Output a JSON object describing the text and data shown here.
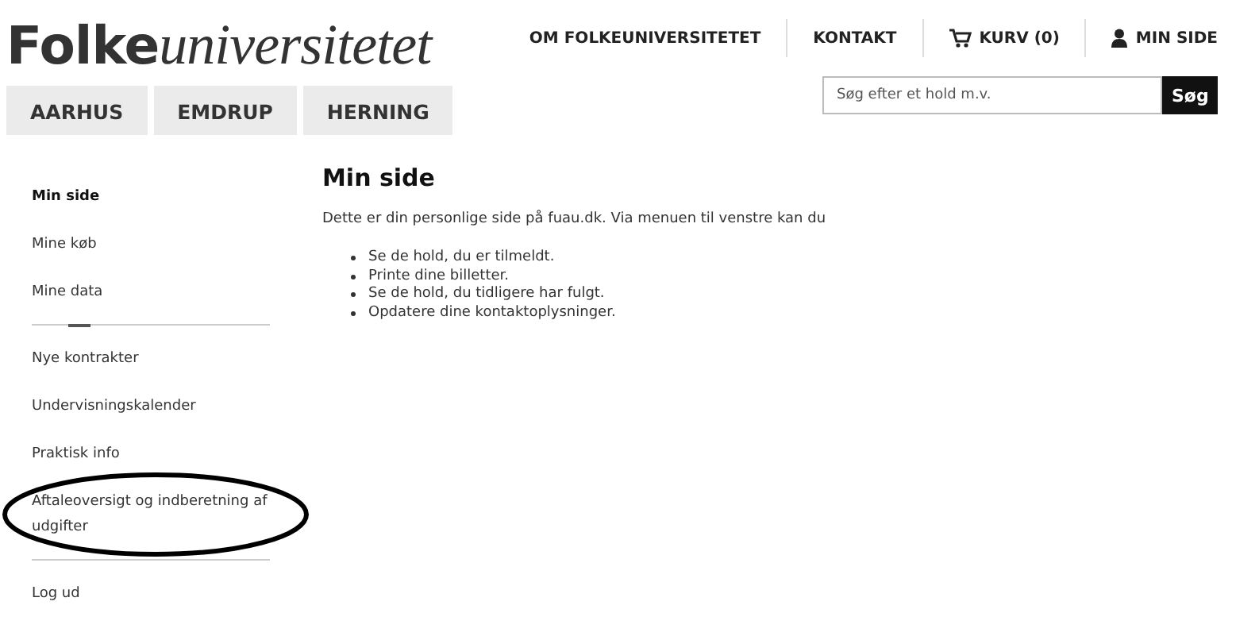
{
  "logo": {
    "bold": "Folke",
    "italic": "universitetet"
  },
  "city_tabs": [
    {
      "label": "AARHUS"
    },
    {
      "label": "EMDRUP"
    },
    {
      "label": "HERNING"
    }
  ],
  "top_nav": [
    {
      "label": "OM FOLKEUNIVERSITETET",
      "kind": "text"
    },
    {
      "label": "KONTAKT",
      "kind": "text"
    },
    {
      "label": "KURV (0)",
      "kind": "cart"
    },
    {
      "label": "MIN SIDE",
      "kind": "user"
    }
  ],
  "search": {
    "placeholder": "Søg efter et hold m.v.",
    "button": "Søg"
  },
  "sidebar": {
    "groups": [
      {
        "items": [
          {
            "label": "Min side",
            "selected": true
          },
          {
            "label": "Mine køb",
            "selected": false
          },
          {
            "label": "Mine data",
            "selected": false
          }
        ]
      },
      {
        "items": [
          {
            "label": "Nye kontrakter",
            "selected": false
          },
          {
            "label": "Undervisningskalender",
            "selected": false
          },
          {
            "label": "Praktisk info",
            "selected": false
          },
          {
            "label": "Aftaleoversigt og indberetning af udgifter",
            "selected": false,
            "circled": true
          }
        ]
      },
      {
        "items": [
          {
            "label": "Log ud",
            "selected": false
          }
        ]
      }
    ]
  },
  "main": {
    "heading": "Min side",
    "intro": "Dette er din personlige side på fuau.dk. Via menuen til venstre kan du",
    "bullets": [
      "Se de hold, du er tilmeldt.",
      "Printe dine billetter.",
      "Se de hold, du tidligere har fulgt.",
      "Opdatere dine kontaktoplysninger."
    ]
  }
}
